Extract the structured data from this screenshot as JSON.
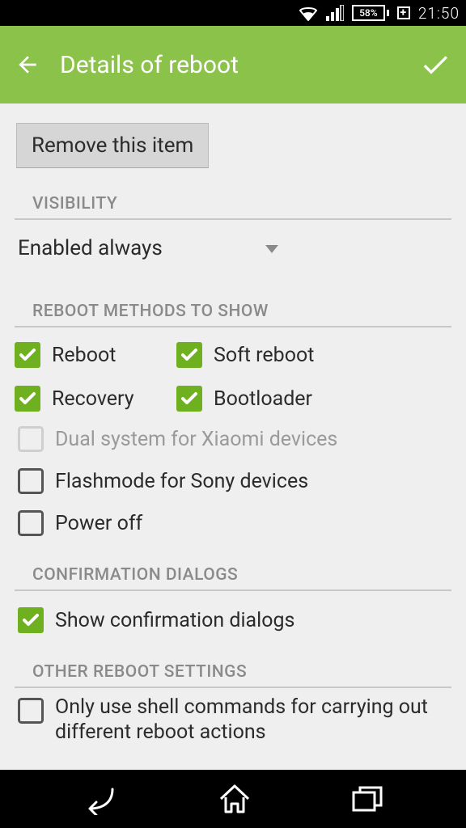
{
  "status": {
    "battery_pct": "58%",
    "time": "21:50"
  },
  "appbar": {
    "title": "Details of reboot"
  },
  "remove_button_label": "Remove this item",
  "sections": {
    "visibility_header": "VISIBILITY",
    "visibility_value": "Enabled always",
    "methods_header": "REBOOT METHODS TO SHOW",
    "confirm_header": "CONFIRMATION DIALOGS",
    "other_header": "OTHER REBOOT SETTINGS"
  },
  "methods": {
    "reboot": {
      "label": "Reboot",
      "checked": true,
      "enabled": true
    },
    "soft_reboot": {
      "label": "Soft reboot",
      "checked": true,
      "enabled": true
    },
    "recovery": {
      "label": "Recovery",
      "checked": true,
      "enabled": true
    },
    "bootloader": {
      "label": "Bootloader",
      "checked": true,
      "enabled": true
    },
    "dual_system": {
      "label": "Dual system for Xiaomi devices",
      "checked": false,
      "enabled": false
    },
    "flashmode": {
      "label": "Flashmode for Sony devices",
      "checked": false,
      "enabled": true
    },
    "power_off": {
      "label": "Power off",
      "checked": false,
      "enabled": true
    }
  },
  "confirm": {
    "label": "Show confirmation dialogs",
    "checked": true
  },
  "other": {
    "shell_only": {
      "label": "Only use shell commands for carrying out different reboot actions",
      "checked": false
    }
  },
  "colors": {
    "accent": "#6eb01f",
    "appbar": "#8bc34a"
  }
}
